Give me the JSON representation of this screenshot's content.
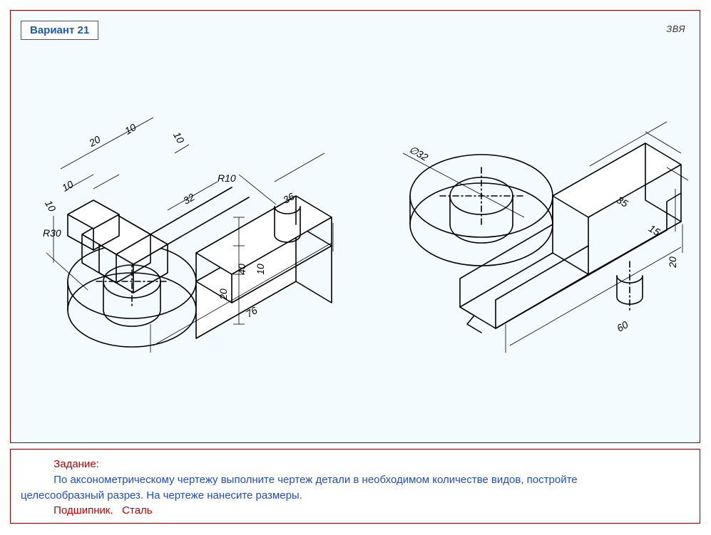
{
  "variant_label": "Вариант 21",
  "corner_mark": "ЗВЯ",
  "task": {
    "heading": "Задание:",
    "body_line1": "По аксонометрическому чертежу выполните чертеж детали в необходимом количестве видов, постройте",
    "body_line2": "целесообразный разрез. На чертеже нанесите размеры.",
    "part_name": "Подшипник.",
    "material": "Сталь"
  },
  "left_view_dimensions": {
    "d1": "20",
    "d2": "10",
    "d3": "10",
    "d4": "10",
    "d5": "10",
    "d_r10": "R10",
    "d_32": "32",
    "d_36": "36",
    "d_r30": "R30",
    "d_20v": "20",
    "d_40": "40",
    "d_10v": "10",
    "d_76": "76"
  },
  "right_view_dimensions": {
    "d_phi32": "∅32",
    "d_35": "35",
    "d_15": "15",
    "d_20": "20",
    "d_60": "60"
  }
}
